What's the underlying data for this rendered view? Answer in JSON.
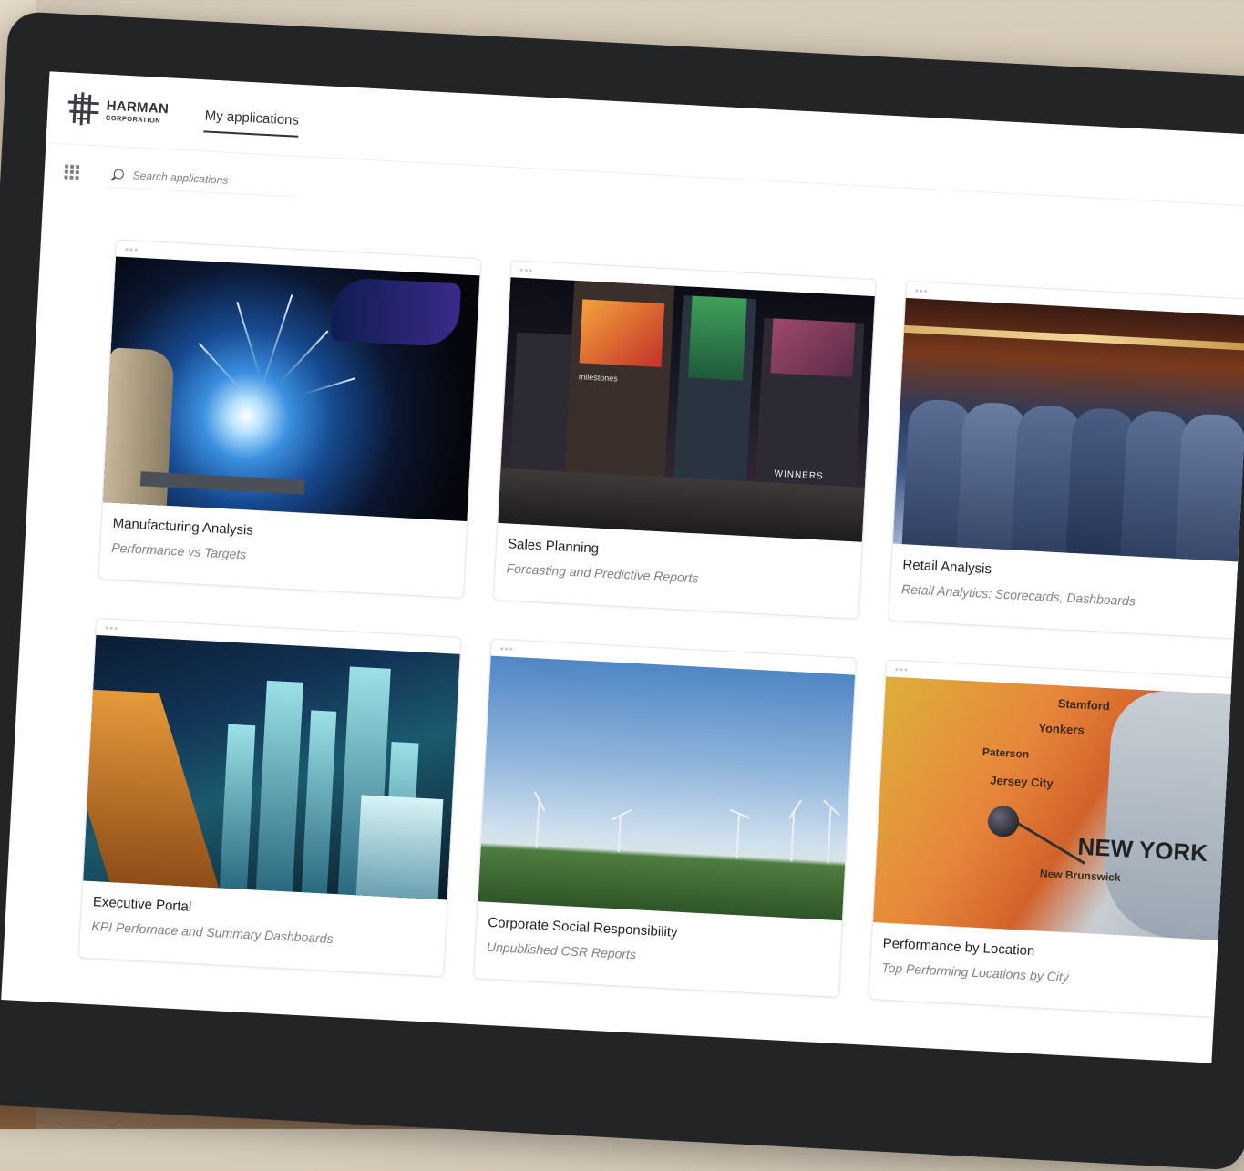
{
  "brand": {
    "name": "HARMAN",
    "sub": "CORPORATION"
  },
  "nav": {
    "active_tab": "My applications"
  },
  "search": {
    "placeholder": "Search applications"
  },
  "cards": [
    {
      "title": "Manufacturing Analysis",
      "subtitle": "Performance vs Targets",
      "image": "welding-sparks"
    },
    {
      "title": "Sales Planning",
      "subtitle": "Forcasting and Predictive Reports",
      "image": "city-billboards-night"
    },
    {
      "title": "Retail Analysis",
      "subtitle": "Retail Analytics: Scorecards, Dashboards",
      "image": "clothing-rack"
    },
    {
      "title": "Executive Portal",
      "subtitle": "KPI Perfornace and Summary Dashboards",
      "image": "city-skyline-aerial-night"
    },
    {
      "title": "Corporate Social Responsibility",
      "subtitle": "Unpublished CSR Reports",
      "image": "wind-turbines-field"
    },
    {
      "title": "Performance by Location",
      "subtitle": "Top Performing Locations by City",
      "image": "map-with-pin-new-york"
    }
  ],
  "map_labels": {
    "city": "NEW YORK",
    "l1": "Yonkers",
    "l2": "Paterson",
    "l3": "Jersey City",
    "l4": "New Brunswick",
    "l5": "Stamford"
  },
  "city_signs": {
    "s1": "milestones",
    "s2": "WINNERS"
  }
}
